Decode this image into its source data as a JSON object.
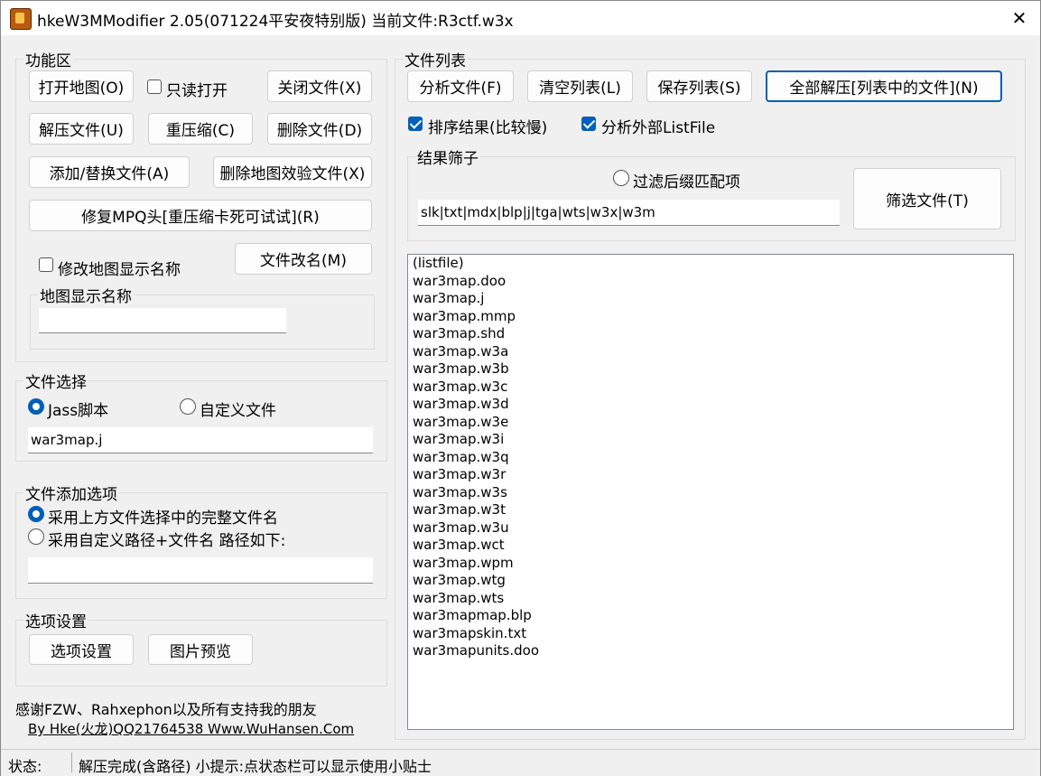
{
  "title": "hkeW3MModifier 2.05(071224平安夜特别版) 当前文件:R3ctf.w3x",
  "close": "✕",
  "func_area": {
    "legend": "功能区",
    "open_map": "打开地图(O)",
    "readonly_open": "只读打开",
    "close_file": "关闭文件(X)",
    "extract_file": "解压文件(U)",
    "recompress": "重压缩(C)",
    "delete_file": "删除文件(D)",
    "add_replace": "添加/替换文件(A)",
    "delete_checksum": "删除地图效验文件(X)",
    "repair_mpq": "修复MPQ头[重压缩卡死可试试](R)",
    "modify_name": "修改地图显示名称",
    "rename_file": "文件改名(M)",
    "map_name_legend": "地图显示名称",
    "map_name_value": ""
  },
  "file_select": {
    "legend": "文件选择",
    "opt_jass": "Jass脚本",
    "opt_custom": "自定义文件",
    "value": "war3map.j"
  },
  "add_options": {
    "legend": "文件添加选项",
    "opt_full": "采用上方文件选择中的完整文件名",
    "opt_custom": "采用自定义路径+文件名 路径如下:",
    "path_value": ""
  },
  "options": {
    "legend": "选项设置",
    "settings": "选项设置",
    "preview": "图片预览"
  },
  "credits": {
    "line1": "感谢FZW、Rahxephon以及所有支持我的朋友",
    "line2": "By Hke(火龙)QQ21764538 Www.WuHansen.Com"
  },
  "file_list": {
    "legend": "文件列表",
    "analyze": "分析文件(F)",
    "clear": "清空列表(L)",
    "save": "保存列表(S)",
    "extract_all": "全部解压[列表中的文件](N)",
    "sort_label": "排序结果(比较慢)",
    "analyze_external": "分析外部ListFile",
    "filter_legend": "结果筛子",
    "filter_suffix": "过滤后缀匹配项",
    "filter_value": "slk|txt|mdx|blp|j|tga|wts|w3x|w3m",
    "filter_button": "筛选文件(T)",
    "items": [
      "(listfile)",
      "war3map.doo",
      "war3map.j",
      "war3map.mmp",
      "war3map.shd",
      "war3map.w3a",
      "war3map.w3b",
      "war3map.w3c",
      "war3map.w3d",
      "war3map.w3e",
      "war3map.w3i",
      "war3map.w3q",
      "war3map.w3r",
      "war3map.w3s",
      "war3map.w3t",
      "war3map.w3u",
      "war3map.wct",
      "war3map.wpm",
      "war3map.wtg",
      "war3map.wts",
      "war3mapmap.blp",
      "war3mapskin.txt",
      "war3mapunits.doo"
    ]
  },
  "status": {
    "label": "状态:",
    "text": "解压完成(含路径) 小提示:点状态栏可以显示使用小贴士"
  }
}
